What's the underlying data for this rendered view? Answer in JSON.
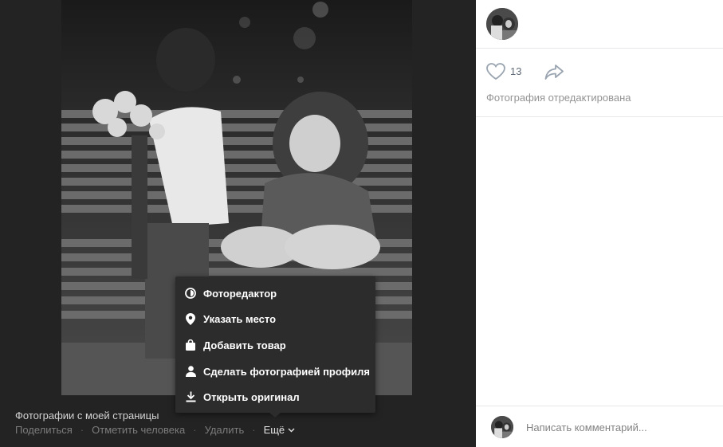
{
  "viewer": {
    "album_title": "Фотографии с моей страницы",
    "actions": {
      "share": "Поделиться",
      "tag_person": "Отметить человека",
      "delete": "Удалить",
      "more": "Ещё",
      "separator": "·"
    },
    "menu": [
      {
        "label": "Фоторедактор",
        "icon": "photo-editor-icon"
      },
      {
        "label": "Указать место",
        "icon": "location-pin-icon"
      },
      {
        "label": "Добавить товар",
        "icon": "shopping-bag-icon"
      },
      {
        "label": "Сделать фотографией профиля",
        "icon": "person-icon"
      },
      {
        "label": "Открыть оригинал",
        "icon": "download-icon"
      }
    ]
  },
  "panel": {
    "likes_count": "13",
    "edited_note": "Фотография отредактирована",
    "comment_placeholder": "Написать комментарий..."
  },
  "colors": {
    "viewer_bg": "#232323",
    "menu_bg": "#2c2c2c",
    "link_gray": "#7c7c7c",
    "divider": "#e7e8ec"
  }
}
